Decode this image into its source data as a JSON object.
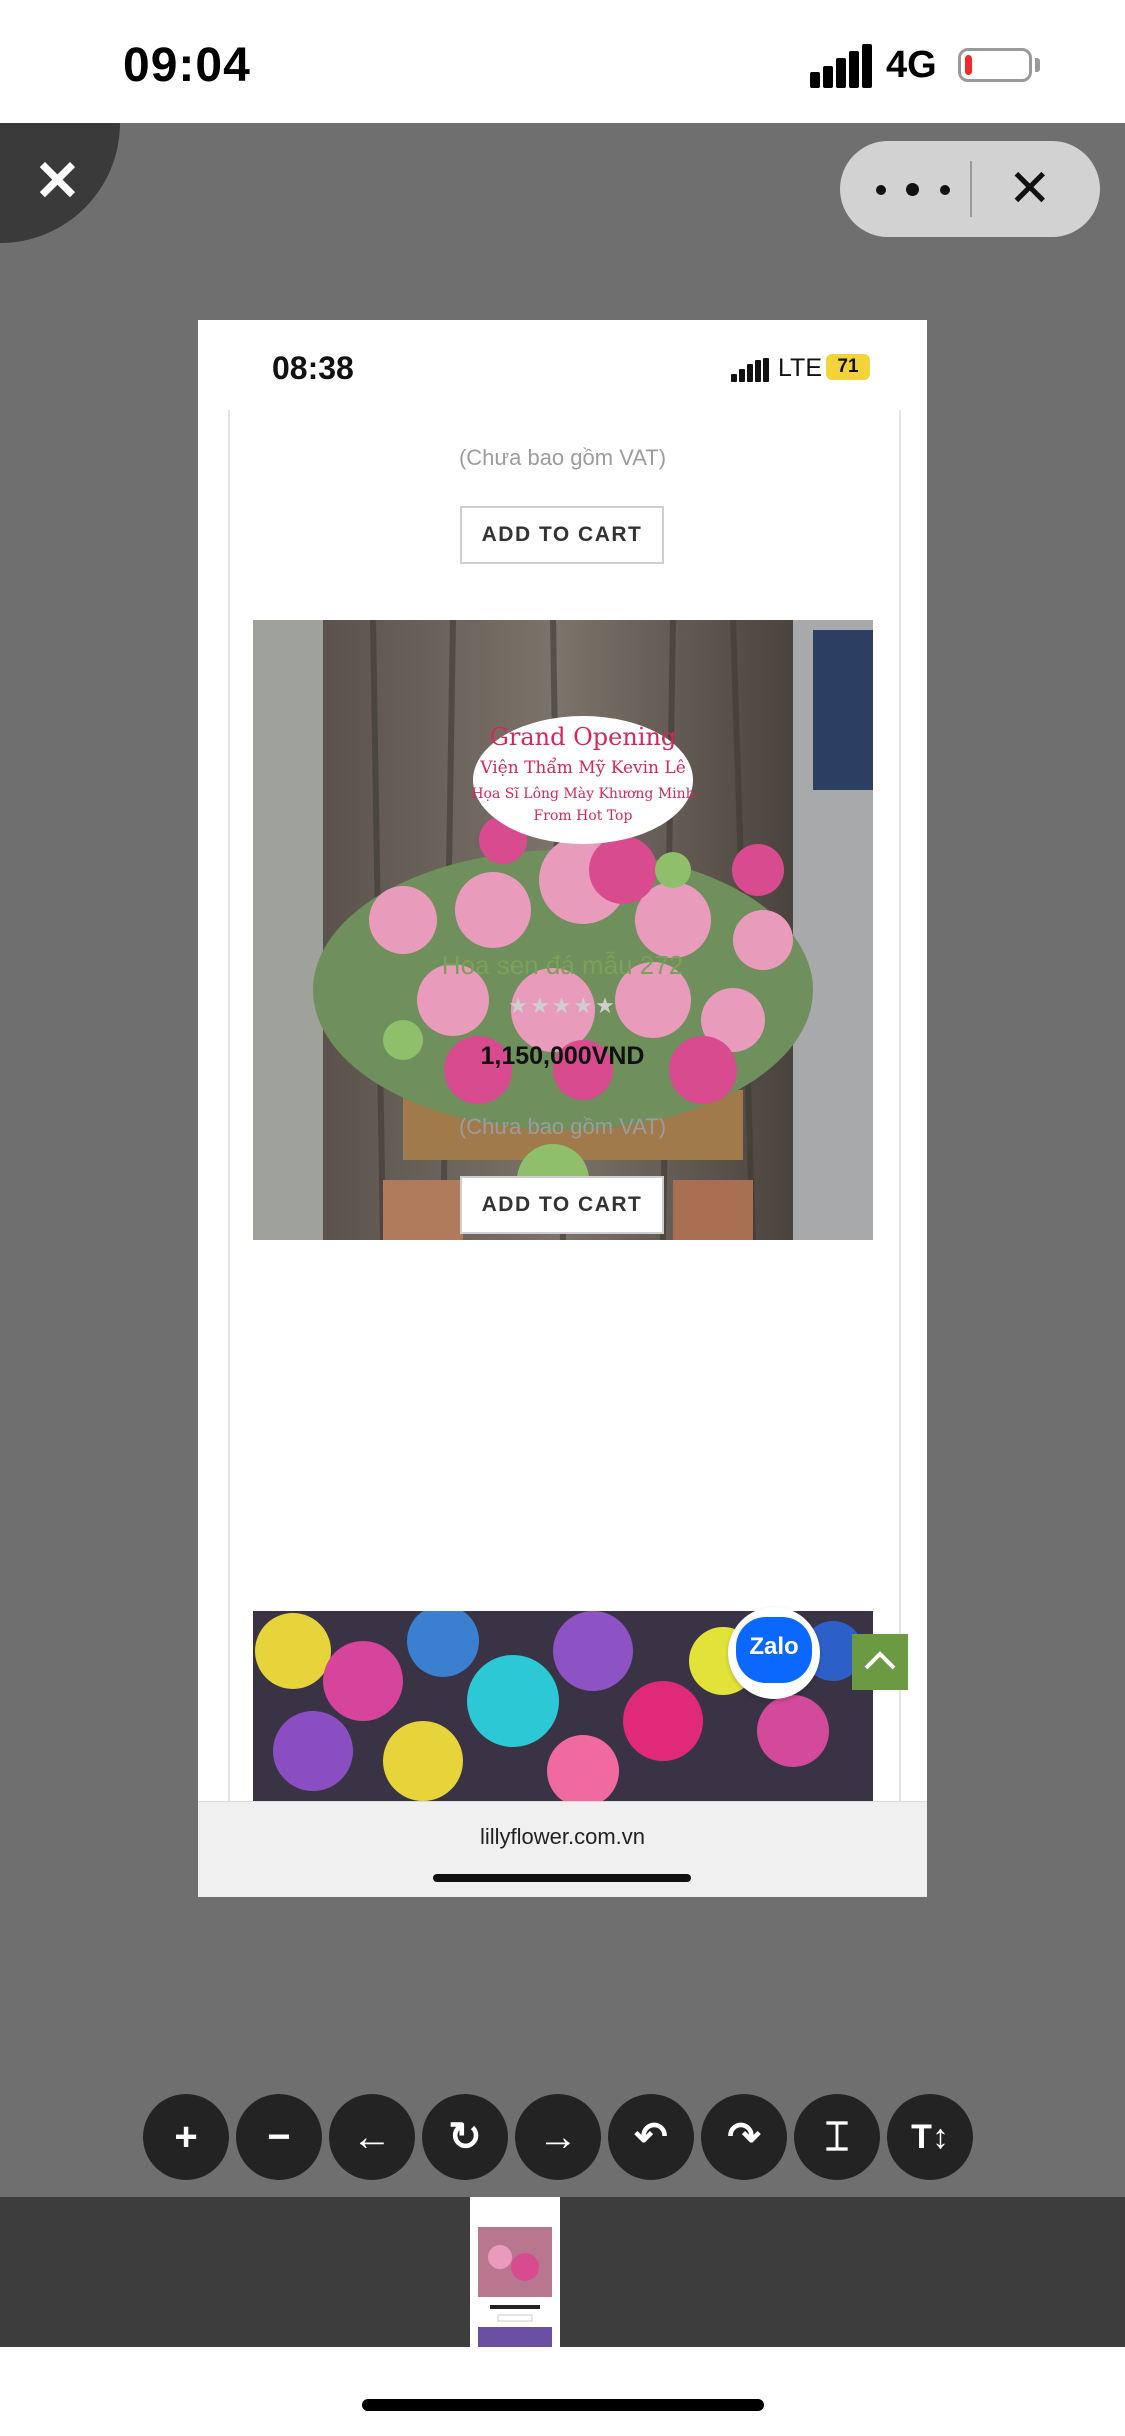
{
  "status_bar": {
    "time": "09:04",
    "network": "4G",
    "battery_level": 0.12
  },
  "viewer": {
    "close_label": "✕",
    "more_label": "•••",
    "capsule_close_label": "✕",
    "toolbar": {
      "zoom_in": "+",
      "zoom_out": "−",
      "prev": "←",
      "rotate": "↻",
      "next": "→",
      "undo": "↶",
      "redo": "↷",
      "text_a": "⌶",
      "text_size": "T↕"
    }
  },
  "screenshot": {
    "time": "08:38",
    "network": "LTE",
    "battery": "71",
    "vat_note_1": "(Chưa bao gồm VAT)",
    "add_to_cart_1": "ADD TO CART",
    "product": {
      "title": "Hoa sen đá mẫu 272",
      "rating": "★★★★★",
      "price": "1,150,000VND",
      "vat_note": "(Chưa bao gồm VAT)",
      "add_to_cart": "ADD TO CART",
      "sign_lines": [
        "Grand Opening",
        "Viện Thẩm Mỹ Kevin Lê",
        "Họa Sĩ Lông Mày Khương Minh",
        "From Hot Top"
      ]
    },
    "zalo_label": "Zalo",
    "url": "lillyflower.com.vn"
  }
}
